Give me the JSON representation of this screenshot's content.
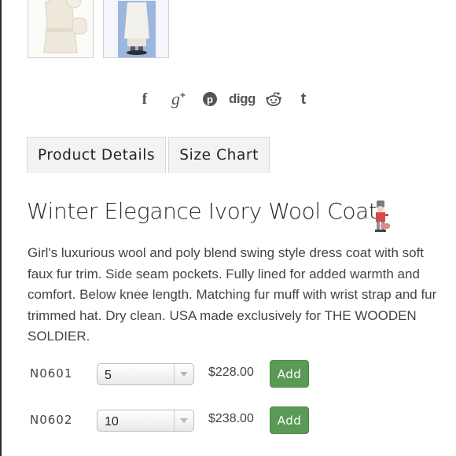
{
  "gallery": {
    "thumbnails": [
      {
        "icon": "coat-flatlay-photo"
      },
      {
        "icon": "girl-in-coat-photo"
      }
    ]
  },
  "share": {
    "icons": [
      "facebook-icon",
      "google-plus-icon",
      "pinterest-icon",
      "digg-icon",
      "reddit-icon",
      "tumblr-icon"
    ],
    "facebook": "f",
    "google_plus": "g",
    "pinterest": "p",
    "digg": "digg",
    "tumblr": "t"
  },
  "tabs": [
    {
      "label": "Product Details"
    },
    {
      "label": "Size Chart"
    }
  ],
  "product": {
    "title": "Winter Elegance Ivory Wool Coat",
    "description": "Girl's luxurious wool and poly blend swing style dress coat with soft faux fur trim. Side seam pockets. Fully lined for added warmth and comfort. Below knee length. Matching fur muff with wrist strap and fur trimmed hat. Dry clean. USA made exclusively for THE WOODEN SOLDIER."
  },
  "variants": [
    {
      "sku": "N0601",
      "size": "5",
      "price": "$228.00",
      "button": "Add"
    },
    {
      "sku": "N0602",
      "size": "10",
      "price": "$238.00",
      "button": "Add"
    }
  ],
  "colors": {
    "add_button": "#5a9a55",
    "tab_background": "#f3f3f3",
    "share_icon": "#555555"
  }
}
